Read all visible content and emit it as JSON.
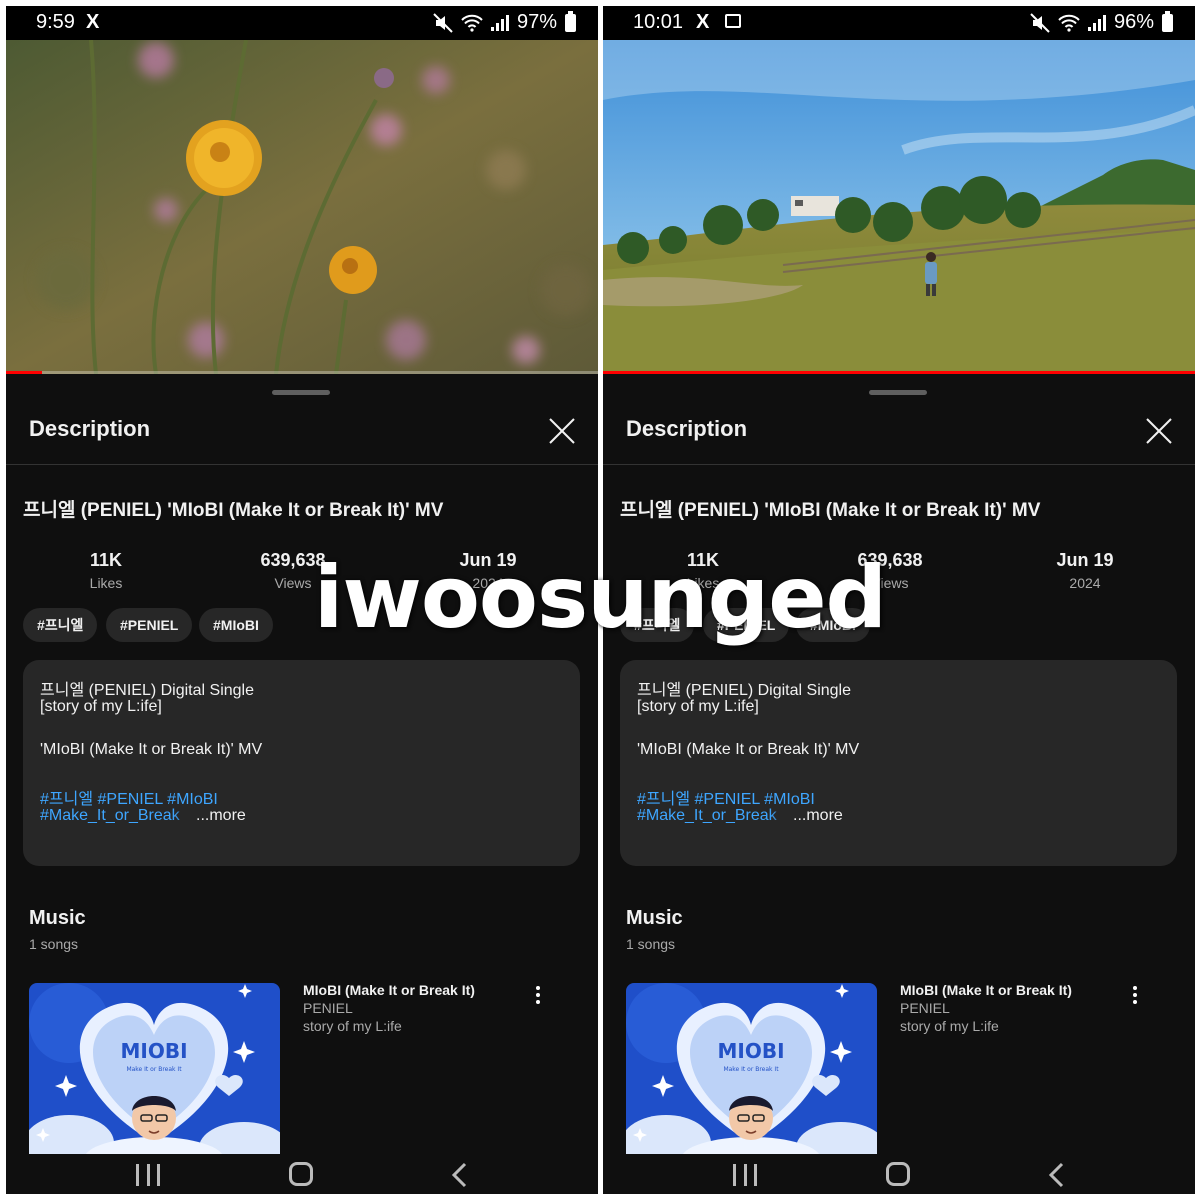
{
  "screens": [
    {
      "status": {
        "time": "9:59",
        "battery": "97%",
        "x_logo": "X"
      },
      "video_progress": 0.06,
      "sheet_title": "Description",
      "video_title": "프니엘 (PENIEL) 'MIoBI (Make It or Break It)' MV",
      "stats": [
        {
          "value": "11K",
          "label": "Likes"
        },
        {
          "value": "639,638",
          "label": "Views"
        },
        {
          "value": "Jun 19",
          "label": "2024"
        }
      ],
      "tags": [
        "#프니엘",
        "#PENIEL",
        "#MIoBI"
      ],
      "description": {
        "line1": "프니엘 (PENIEL) Digital Single",
        "line2": "[story of my L:ife]",
        "line3": "'MIoBI (Make It or Break It)' MV",
        "hashtags1": "#프니엘 #PENIEL #MIoBI",
        "hashtags2": "#Make_It_or_Break",
        "more": "...more"
      },
      "music": {
        "title": "Music",
        "count": "1 songs",
        "song_title": "MIoBI (Make It or Break It)",
        "artist": "PENIEL",
        "album": "story of my L:ife",
        "art_logo": "MIOBI",
        "art_subtitle": "Make It or Break It"
      }
    },
    {
      "status": {
        "time": "10:01",
        "battery": "96%",
        "x_logo": "X"
      },
      "video_progress": 1.0,
      "sheet_title": "Description",
      "video_title": "프니엘 (PENIEL) 'MIoBI (Make It or Break It)' MV",
      "stats": [
        {
          "value": "11K",
          "label": "Likes"
        },
        {
          "value": "639,638",
          "label": "Views"
        },
        {
          "value": "Jun 19",
          "label": "2024"
        }
      ],
      "tags": [
        "#프니엘",
        "#PENIEL",
        "#MIoBI"
      ],
      "description": {
        "line1": "프니엘 (PENIEL) Digital Single",
        "line2": "[story of my L:ife]",
        "line3": "'MIoBI (Make It or Break It)' MV",
        "hashtags1": "#프니엘 #PENIEL #MIoBI",
        "hashtags2": "#Make_It_or_Break",
        "more": "...more"
      },
      "music": {
        "title": "Music",
        "count": "1 songs",
        "song_title": "MIoBI (Make It or Break It)",
        "artist": "PENIEL",
        "album": "story of my L:ife",
        "art_logo": "MIOBI",
        "art_subtitle": "Make It or Break It"
      }
    }
  ],
  "watermark": "iwoosunged",
  "colors": {
    "background": "#0f0f0f",
    "card": "#272727",
    "hashtag": "#3ea6ff",
    "progress": "#ff0000"
  }
}
